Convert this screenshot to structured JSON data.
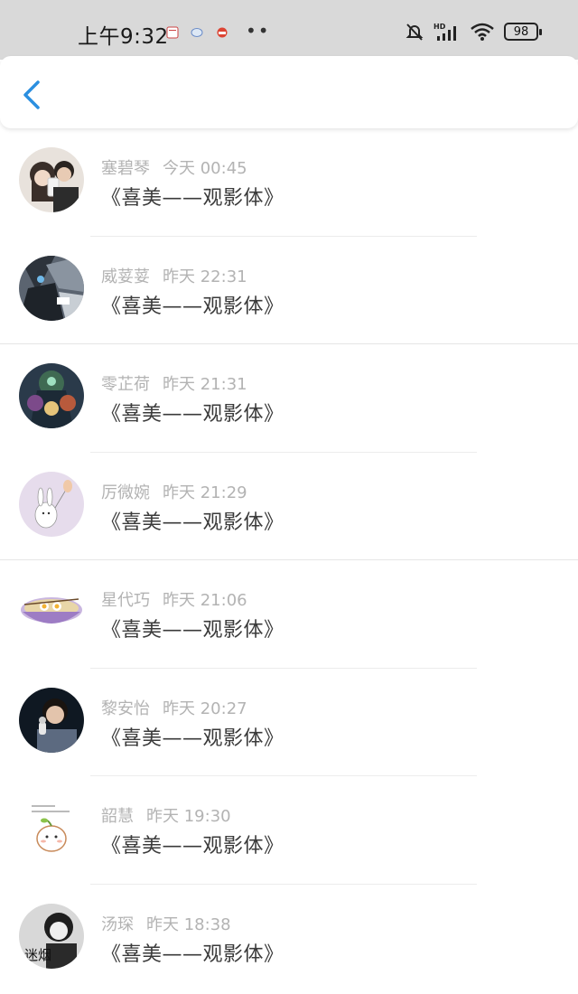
{
  "status_bar": {
    "time": "上午9:32",
    "battery": "98",
    "network": "HD"
  },
  "nav": {
    "back_icon": "chevron-left-icon"
  },
  "messages": [
    {
      "name": "塞碧琴",
      "time": "今天 00:45",
      "text": "《喜美——观影体》",
      "avatar": "couple-photo"
    },
    {
      "name": "威荽荽",
      "time": "昨天 22:31",
      "text": "《喜美——观影体》",
      "avatar": "mecha-art"
    },
    {
      "name": "零芷荷",
      "time": "昨天 21:31",
      "text": "《喜美——观影体》",
      "avatar": "anime-group"
    },
    {
      "name": "厉微婉",
      "time": "昨天 21:29",
      "text": "《喜美——观影体》",
      "avatar": "bunny-balloon"
    },
    {
      "name": "星代巧",
      "time": "昨天 21:06",
      "text": "《喜美——观影体》",
      "avatar": "noodle-bowl"
    },
    {
      "name": "黎安怡",
      "time": "昨天 20:27",
      "text": "《喜美——观影体》",
      "avatar": "singer-photo"
    },
    {
      "name": "韶慧",
      "time": "昨天 19:30",
      "text": "《喜美——观影体》",
      "avatar": "sprout-doodle"
    },
    {
      "name": "汤琛",
      "time": "昨天 18:38",
      "text": "《喜美——观影体》",
      "avatar": "girl-bw",
      "avatar_text": "迷烟"
    }
  ]
}
